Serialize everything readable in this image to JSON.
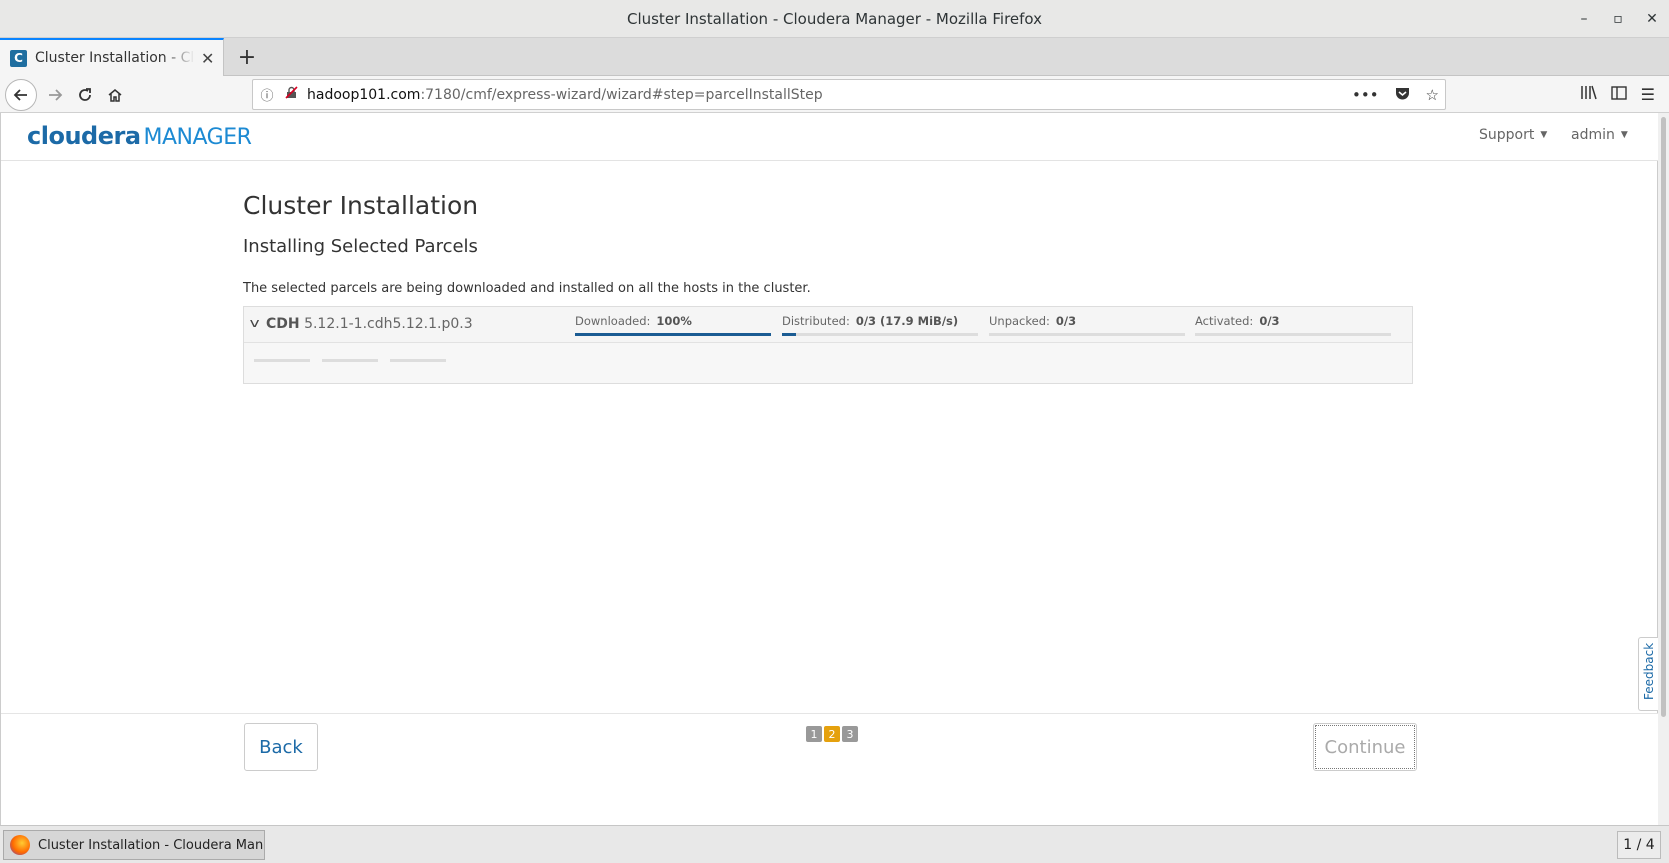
{
  "window": {
    "title": "Cluster Installation - Cloudera Manager - Mozilla Firefox",
    "minimize": "–",
    "maximize": "▫",
    "close": "✕"
  },
  "browser": {
    "tab_title": "Cluster Installation - Cloudera Manager",
    "tab_favicon": "C",
    "tab_close": "✕",
    "new_tab": "+",
    "url_host": "hadoop101.com",
    "url_path": ":7180/cmf/express-wizard/wizard#step=parcelInstallStep",
    "page_actions": "•••"
  },
  "app": {
    "logo_brand": "cloudera",
    "logo_product": "MANAGER",
    "menu_support": "Support",
    "menu_admin": "admin",
    "accent_color": "#1c6aa7"
  },
  "main": {
    "title": "Cluster Installation",
    "subtitle": "Installing Selected Parcels",
    "description": "The selected parcels are being downloaded and installed on all the hosts in the cluster.",
    "parcel": {
      "name": "CDH",
      "version": "5.12.1-1.cdh5.12.1.p0.3",
      "stages": [
        {
          "label": "Downloaded:",
          "value": "100%",
          "progress": 1.0
        },
        {
          "label": "Distributed:",
          "value": "0/3 (17.9 MiB/s)",
          "progress": 0.07
        },
        {
          "label": "Unpacked:",
          "value": "0/3",
          "progress": 0
        },
        {
          "label": "Activated:",
          "value": "0/3",
          "progress": 0
        }
      ]
    }
  },
  "footer": {
    "back_label": "Back",
    "continue_label": "Continue",
    "steps": [
      "1",
      "2",
      "3"
    ],
    "active_step": "2"
  },
  "feedback_label": "Feedback",
  "taskbar": {
    "item_label": "Cluster Installation - Cloudera Manag...",
    "pager": "1 / 4"
  }
}
